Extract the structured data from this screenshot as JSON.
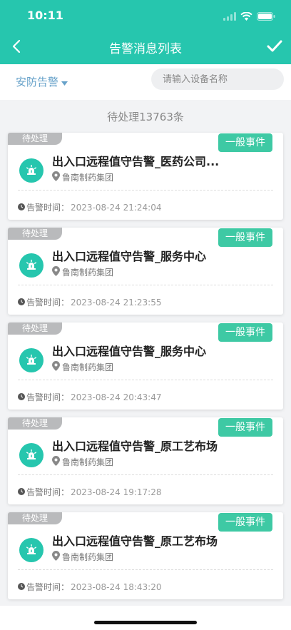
{
  "status_bar": {
    "time": "10:11"
  },
  "nav": {
    "title": "告警消息列表"
  },
  "filter": {
    "type_label": "安防告警",
    "search_placeholder": "请输入设备名称",
    "search_value": ""
  },
  "summary": {
    "count_text": "待处理13763条"
  },
  "colors": {
    "primary": "#26c6ae",
    "badge": "#3ec9a4",
    "filter_text": "#66a1c9",
    "pending_tag": "#b9babc"
  },
  "alarms": [
    {
      "status": "待处理",
      "level": "一般事件",
      "title": "出入口远程值守告警_医药公司...",
      "company": "鲁南制药集团",
      "time_label": "告警时间：",
      "time": "2023-08-24 21:24:04"
    },
    {
      "status": "待处理",
      "level": "一般事件",
      "title": "出入口远程值守告警_服务中心",
      "company": "鲁南制药集团",
      "time_label": "告警时间：",
      "time": "2023-08-24 21:23:55"
    },
    {
      "status": "待处理",
      "level": "一般事件",
      "title": "出入口远程值守告警_服务中心",
      "company": "鲁南制药集团",
      "time_label": "告警时间：",
      "time": "2023-08-24 20:43:47"
    },
    {
      "status": "待处理",
      "level": "一般事件",
      "title": "出入口远程值守告警_原工艺布场",
      "company": "鲁南制药集团",
      "time_label": "告警时间：",
      "time": "2023-08-24 19:17:28"
    },
    {
      "status": "待处理",
      "level": "一般事件",
      "title": "出入口远程值守告警_原工艺布场",
      "company": "鲁南制药集团",
      "time_label": "告警时间：",
      "time": "2023-08-24 18:43:20"
    }
  ]
}
